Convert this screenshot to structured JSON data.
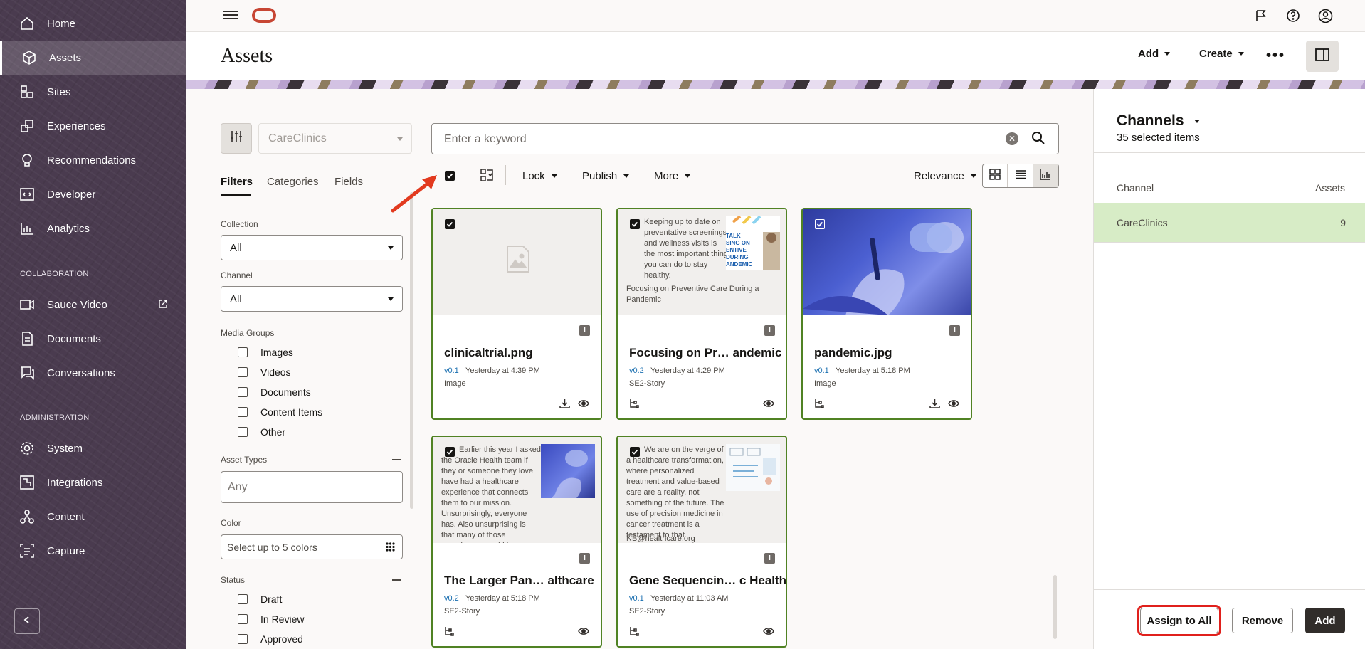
{
  "sidebar": {
    "items": [
      {
        "label": "Home",
        "icon": "home-icon"
      },
      {
        "label": "Assets",
        "icon": "cube-icon"
      },
      {
        "label": "Sites",
        "icon": "sites-icon"
      },
      {
        "label": "Experiences",
        "icon": "experiences-icon"
      },
      {
        "label": "Recommendations",
        "icon": "lightbulb-icon"
      },
      {
        "label": "Developer",
        "icon": "code-icon"
      },
      {
        "label": "Analytics",
        "icon": "analytics-icon"
      }
    ],
    "collaboration_heading": "COLLABORATION",
    "collaboration_items": [
      {
        "label": "Sauce Video",
        "icon": "video-icon"
      },
      {
        "label": "Documents",
        "icon": "documents-icon"
      },
      {
        "label": "Conversations",
        "icon": "conversations-icon"
      }
    ],
    "administration_heading": "ADMINISTRATION",
    "administration_items": [
      {
        "label": "System",
        "icon": "gear-icon"
      },
      {
        "label": "Integrations",
        "icon": "integrations-icon"
      },
      {
        "label": "Content",
        "icon": "content-icon"
      },
      {
        "label": "Capture",
        "icon": "capture-icon"
      }
    ],
    "active": "Assets"
  },
  "header": {
    "title": "Assets",
    "add_label": "Add",
    "create_label": "Create"
  },
  "filters": {
    "repository": "CareClinics",
    "tabs": [
      "Filters",
      "Categories",
      "Fields"
    ],
    "collection_label": "Collection",
    "collection_value": "All",
    "channel_label": "Channel",
    "channel_value": "All",
    "media_groups_label": "Media Groups",
    "media_groups": [
      "Images",
      "Videos",
      "Documents",
      "Content Items",
      "Other"
    ],
    "asset_types_label": "Asset Types",
    "asset_types_placeholder": "Any",
    "color_label": "Color",
    "color_placeholder": "Select up to 5 colors",
    "status_label": "Status",
    "statuses": [
      "Draft",
      "In Review",
      "Approved"
    ]
  },
  "search": {
    "placeholder": "Enter a keyword"
  },
  "toolbar": {
    "lock_label": "Lock",
    "publish_label": "Publish",
    "more_label": "More",
    "sort_label": "Relevance"
  },
  "cards": [
    {
      "name": "clinicaltrial.png",
      "version": "v0.1",
      "time": "Yesterday at 4:39 PM",
      "type": "Image",
      "badge": "I"
    },
    {
      "name": "Focusing on Pr… andemic",
      "version": "v0.2",
      "time": "Yesterday at 4:29 PM",
      "type": "SE2-Story",
      "badge": "I",
      "preview": "Keeping up to date on preventative screenings and wellness visits is the most important thing you can do to stay healthy.",
      "preview_title": "Focusing on Preventive Care During a Pandemic",
      "image_text": "TALK SING ON ENTIVE DURING ANDEMIC"
    },
    {
      "name": "pandemic.jpg",
      "version": "v0.1",
      "time": "Yesterday at 5:18 PM",
      "type": "Image",
      "badge": "I"
    },
    {
      "name": "The Larger Pan… althcare",
      "version": "v0.2",
      "time": "Yesterday at 5:18 PM",
      "type": "SE2-Story",
      "badge": "I",
      "preview": "Earlier this year I asked the Oracle Health team if they or someone they love have had a healthcare experience that connects them to our mission. Unsurprisingly, everyone has. Also unsurprising is that many of those experiences could have been improved if"
    },
    {
      "name": "Gene Sequencin… c Health",
      "version": "v0.1",
      "time": "Yesterday at 11:03 AM",
      "type": "SE2-Story",
      "badge": "I",
      "preview": "We are on the verge of a healthcare transformation, where personalized treatment and value-based care are a reality, not something of the future. The use of precision medicine in cancer treatment is a testament to that.",
      "preview_footer": "NB@healthcare.org"
    }
  ],
  "panel": {
    "title": "Channels",
    "subtitle": "35 selected items",
    "col_channel": "Channel",
    "col_assets": "Assets",
    "rows": [
      {
        "channel": "CareClinics",
        "assets": "9"
      }
    ],
    "assign_all_label": "Assign to All",
    "remove_label": "Remove",
    "add_label": "Add"
  },
  "colors": {
    "sidebar_bg": "#4a3b4f",
    "card_border": "#508223",
    "selected_row": "#d7ecc6",
    "highlight_red": "#e0201c",
    "brand_red": "#c74634"
  }
}
